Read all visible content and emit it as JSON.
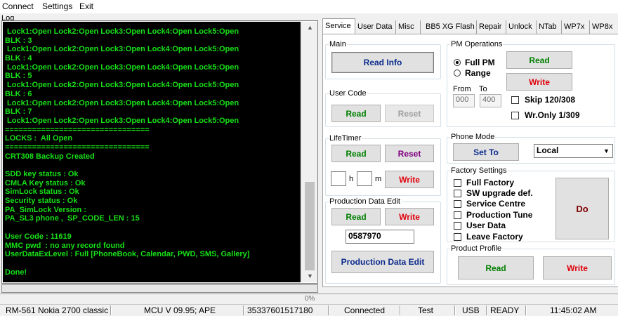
{
  "menu": {
    "items": [
      "Connect",
      "Settings",
      "Exit"
    ]
  },
  "log": {
    "label": "Log",
    "lines": [
      " Lock1:Open Lock2:Open Lock3:Open Lock4:Open Lock5:Open",
      "BLK : 3",
      " Lock1:Open Lock2:Open Lock3:Open Lock4:Open Lock5:Open",
      "BLK : 4",
      " Lock1:Open Lock2:Open Lock3:Open Lock4:Open Lock5:Open",
      "BLK : 5",
      " Lock1:Open Lock2:Open Lock3:Open Lock4:Open Lock5:Open",
      "BLK : 6",
      " Lock1:Open Lock2:Open Lock3:Open Lock4:Open Lock5:Open",
      "BLK : 7",
      " Lock1:Open Lock2:Open Lock3:Open Lock4:Open Lock5:Open",
      "================================",
      "LOCKS :  All Open",
      "================================",
      "CRT308 Backup Created",
      "",
      "SDD key status : Ok",
      "CMLA Key status : Ok",
      "SimLock status : Ok",
      "Security status : Ok",
      "PA_SimLock Version :",
      "PA_SL3 phone ,  SP_CODE_LEN : 15",
      "",
      "User Code : 11619",
      "MMC pwd  : no any record found",
      "UserDataExLevel : Full [PhoneBook, Calendar, PWD, SMS, Gallery]",
      "",
      "Done!"
    ]
  },
  "progress": {
    "percent_label": "0%",
    "fraction": 0.0
  },
  "status": {
    "model": "RM-561 Nokia 2700 classic",
    "mcu": "MCU V 09.95; APE",
    "imei": "35337601517180",
    "connection": "Connected",
    "mode": "Test",
    "interface": "USB",
    "state": "READY",
    "time": "11:45:02 AM"
  },
  "tabs": [
    "Service",
    "User Data",
    "Misc",
    "BB5 XG Flash",
    "Repair",
    "Unlock",
    "NTab",
    "WP7x",
    "WP8x"
  ],
  "main": {
    "title": "Main",
    "read_info": "Read Info"
  },
  "user_code": {
    "title": "User Code",
    "read": "Read",
    "reset": "Reset"
  },
  "lifetimer": {
    "title": "LifeTimer",
    "read": "Read",
    "reset": "Reset",
    "hours_value": "",
    "hours_unit": "h",
    "minutes_value": "",
    "minutes_unit": "m",
    "write": "Write"
  },
  "production_data": {
    "title": "Production Data Edit",
    "read": "Read",
    "write": "Write",
    "value": "0587970",
    "edit_button": "Production Data Edit"
  },
  "pm_operations": {
    "title": "PM Operations",
    "full_pm": "Full PM",
    "range": "Range",
    "read": "Read",
    "write": "Write",
    "from_label": "From",
    "to_label": "To",
    "from_value": "000",
    "to_value": "400",
    "skip": "Skip 120/308",
    "wr_only": "Wr.Only 1/309"
  },
  "phone_mode": {
    "title": "Phone Mode",
    "set_to": "Set To",
    "selected": "Local"
  },
  "factory_settings": {
    "title": "Factory Settings",
    "options": [
      "Full Factory",
      "SW upgrade def.",
      "Service Centre",
      "Production Tune",
      "User Data",
      "Leave Factory"
    ],
    "do": "Do"
  },
  "product_profile": {
    "title": "Product Profile",
    "read": "Read",
    "write": "Write"
  },
  "icons": [
    "chevron-up-icon",
    "chevron-down-icon",
    "combo-arrow-icon"
  ]
}
